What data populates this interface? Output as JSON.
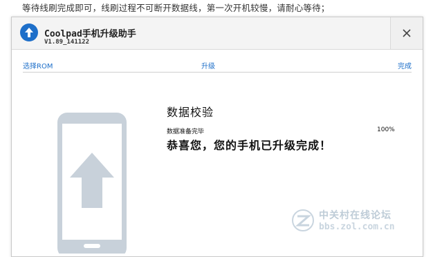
{
  "caption": "等待线刷完成即可，线刷过程不可断开数据线，第一次开机较慢，请耐心等待；",
  "window": {
    "title": "Coolpad手机升级助手",
    "version": "V1.89_141122",
    "icons": {
      "logo": "up-arrow-circle-icon",
      "close": "close-icon"
    }
  },
  "steps": {
    "items": [
      {
        "label": "选择ROM"
      },
      {
        "label": "升级"
      },
      {
        "label": "完成"
      }
    ]
  },
  "status": {
    "title": "数据校验",
    "progress_label": "数据准备完毕",
    "progress_percent": "100%",
    "message": "恭喜您，您的手机已升级完成！"
  },
  "watermark": {
    "line1": "中关村在线论坛",
    "line2": "bbs.zol.com.cn"
  },
  "colors": {
    "accent": "#1e6fc9",
    "phone": "#c8d1da"
  }
}
